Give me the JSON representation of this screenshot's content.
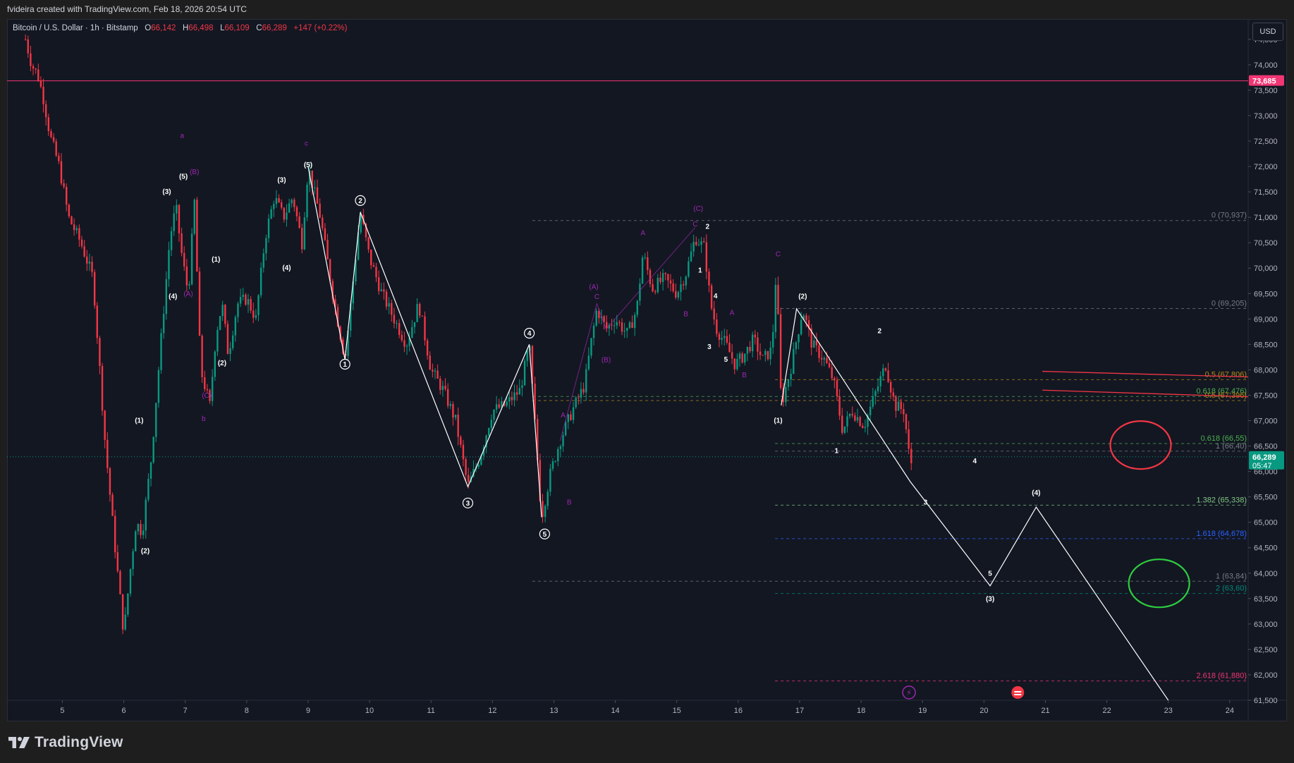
{
  "header": {
    "credit": "fvideira created with TradingView.com, Feb 18, 2026 20:54 UTC"
  },
  "legend": {
    "title": "Bitcoin / U.S. Dollar · 1h · Bitstamp",
    "open_label": "O",
    "open": "66,142",
    "high_label": "H",
    "high": "66,498",
    "low_label": "L",
    "low": "66,109",
    "close_label": "C",
    "close": "66,289",
    "change": "+147 (+0.22%)"
  },
  "currency_button": "USD",
  "footer": {
    "brand": "TradingView"
  },
  "colors": {
    "up": "#089981",
    "down": "#f23645",
    "background": "#131722",
    "wave_purple": "#9c27b0",
    "resistance": "#f23674",
    "accent_blue": "#2962ff"
  },
  "chart_data": {
    "type": "candlestick",
    "symbol": "Bitcoin / U.S. Dollar",
    "timeframe": "1h",
    "exchange": "Bitstamp",
    "y_axis": {
      "min": 61500,
      "max": 74900,
      "ticks": [
        "61,500",
        "62,000",
        "62,500",
        "63,000",
        "63,500",
        "64,000",
        "64,500",
        "65,000",
        "65,500",
        "66,000",
        "66,500",
        "67,000",
        "67,500",
        "68,000",
        "68,500",
        "69,000",
        "69,500",
        "70,000",
        "70,500",
        "71,000",
        "71,500",
        "72,000",
        "72,500",
        "73,000",
        "73,500",
        "74,000",
        "74,500"
      ]
    },
    "x_axis": {
      "start_day": 4.1,
      "end_day": 24.3,
      "ticks": [
        "5",
        "6",
        "7",
        "8",
        "9",
        "10",
        "11",
        "12",
        "13",
        "14",
        "15",
        "16",
        "17",
        "18",
        "19",
        "20",
        "21",
        "22",
        "23",
        "24"
      ]
    },
    "price_badges": [
      {
        "value": 73685,
        "label": "73,685",
        "color": "#f23674"
      },
      {
        "value": 66289,
        "label": "66,289",
        "countdown": "05:47",
        "color": "#089981"
      }
    ],
    "resistance_line": 73685,
    "current_price": 66289,
    "price_path": [
      [
        4.4,
        74500
      ],
      [
        4.5,
        74000
      ],
      [
        4.6,
        73800
      ],
      [
        4.7,
        73300
      ],
      [
        4.8,
        72600
      ],
      [
        4.95,
        72000
      ],
      [
        5.1,
        71000
      ],
      [
        5.3,
        70500
      ],
      [
        5.5,
        69800
      ],
      [
        5.7,
        66500
      ],
      [
        5.85,
        64600
      ],
      [
        6.0,
        62800
      ],
      [
        6.1,
        64000
      ],
      [
        6.2,
        65000
      ],
      [
        6.3,
        64800
      ],
      [
        6.45,
        66300
      ],
      [
        6.6,
        68500
      ],
      [
        6.75,
        70600
      ],
      [
        6.85,
        71200
      ],
      [
        6.95,
        70200
      ],
      [
        7.05,
        69500
      ],
      [
        7.15,
        71300
      ],
      [
        7.25,
        68000
      ],
      [
        7.4,
        67300
      ],
      [
        7.5,
        68700
      ],
      [
        7.6,
        69300
      ],
      [
        7.7,
        68300
      ],
      [
        7.85,
        69300
      ],
      [
        8.0,
        69400
      ],
      [
        8.15,
        69000
      ],
      [
        8.3,
        70600
      ],
      [
        8.45,
        71400
      ],
      [
        8.6,
        71000
      ],
      [
        8.75,
        71400
      ],
      [
        8.9,
        70500
      ],
      [
        9.0,
        72000
      ],
      [
        9.2,
        71000
      ],
      [
        9.4,
        69500
      ],
      [
        9.6,
        68200
      ],
      [
        9.85,
        71100
      ],
      [
        10.0,
        70200
      ],
      [
        10.2,
        69500
      ],
      [
        10.4,
        69000
      ],
      [
        10.6,
        68500
      ],
      [
        10.8,
        69300
      ],
      [
        11.0,
        68000
      ],
      [
        11.2,
        67600
      ],
      [
        11.4,
        67000
      ],
      [
        11.6,
        65700
      ],
      [
        11.8,
        66300
      ],
      [
        12.0,
        67200
      ],
      [
        12.2,
        67300
      ],
      [
        12.45,
        67600
      ],
      [
        12.6,
        68500
      ],
      [
        12.7,
        66800
      ],
      [
        12.8,
        65100
      ],
      [
        12.95,
        66000
      ],
      [
        13.1,
        66600
      ],
      [
        13.3,
        67200
      ],
      [
        13.5,
        67700
      ],
      [
        13.6,
        68500
      ],
      [
        13.7,
        69200
      ],
      [
        13.85,
        68800
      ],
      [
        14.0,
        69000
      ],
      [
        14.2,
        68700
      ],
      [
        14.35,
        69200
      ],
      [
        14.45,
        70300
      ],
      [
        14.6,
        69600
      ],
      [
        14.8,
        69800
      ],
      [
        15.0,
        69500
      ],
      [
        15.15,
        69900
      ],
      [
        15.3,
        70600
      ],
      [
        15.45,
        70400
      ],
      [
        15.55,
        69300
      ],
      [
        15.65,
        68800
      ],
      [
        15.8,
        68500
      ],
      [
        15.95,
        68100
      ],
      [
        16.1,
        68300
      ],
      [
        16.25,
        68600
      ],
      [
        16.4,
        68200
      ],
      [
        16.55,
        68400
      ],
      [
        16.62,
        70000
      ],
      [
        16.7,
        67300
      ],
      [
        16.85,
        68000
      ],
      [
        17.05,
        69200
      ],
      [
        17.2,
        68500
      ],
      [
        17.4,
        68200
      ],
      [
        17.55,
        67800
      ],
      [
        17.7,
        66800
      ],
      [
        17.85,
        67200
      ],
      [
        18.05,
        66900
      ],
      [
        18.25,
        67600
      ],
      [
        18.4,
        68100
      ],
      [
        18.55,
        67300
      ],
      [
        18.7,
        67200
      ],
      [
        18.8,
        66100
      ],
      [
        18.85,
        66300
      ]
    ],
    "projection_path": [
      [
        16.7,
        67300
      ],
      [
        16.95,
        69200
      ],
      [
        18.8,
        65800
      ],
      [
        20.1,
        63750
      ],
      [
        20.85,
        65300
      ],
      [
        23.0,
        61500
      ]
    ],
    "completed_wave_path": [
      [
        9.0,
        72000
      ],
      [
        9.6,
        68200
      ],
      [
        9.85,
        71100
      ],
      [
        11.6,
        65700
      ],
      [
        12.6,
        68500
      ],
      [
        12.8,
        65100
      ]
    ],
    "wave_labels_white": [
      {
        "t": "(3)",
        "d": 6.7,
        "p": 71460
      },
      {
        "t": "(5)",
        "d": 6.97,
        "p": 71760
      },
      {
        "t": "(1)",
        "d": 7.5,
        "p": 70130
      },
      {
        "t": "(4)",
        "d": 6.8,
        "p": 69400
      },
      {
        "t": "(2)",
        "d": 7.6,
        "p": 68090
      },
      {
        "t": "(1)",
        "d": 6.25,
        "p": 66960
      },
      {
        "t": "(2)",
        "d": 6.35,
        "p": 64390
      },
      {
        "t": "(3)",
        "d": 8.57,
        "p": 71690
      },
      {
        "t": "(5)",
        "d": 9.0,
        "p": 71990
      },
      {
        "t": "(4)",
        "d": 8.65,
        "p": 69960
      },
      {
        "t": "(2)",
        "d": 17.05,
        "p": 69400
      },
      {
        "t": "(1)",
        "d": 16.65,
        "p": 66960
      },
      {
        "t": "(3)",
        "d": 20.1,
        "p": 63450
      },
      {
        "t": "(4)",
        "d": 20.85,
        "p": 65540
      },
      {
        "t": "2",
        "d": 15.5,
        "p": 70770
      },
      {
        "t": "1",
        "d": 15.38,
        "p": 69910
      },
      {
        "t": "4",
        "d": 15.63,
        "p": 69410
      },
      {
        "t": "3",
        "d": 15.53,
        "p": 68410
      },
      {
        "t": "5",
        "d": 15.8,
        "p": 68160
      },
      {
        "t": "2",
        "d": 18.3,
        "p": 68720
      },
      {
        "t": "1",
        "d": 17.6,
        "p": 66360
      },
      {
        "t": "4",
        "d": 19.85,
        "p": 66160
      },
      {
        "t": "3",
        "d": 19.05,
        "p": 65350
      },
      {
        "t": "5",
        "d": 20.1,
        "p": 63950
      }
    ],
    "wave_labels_circled": [
      {
        "t": "1",
        "d": 9.6,
        "p": 68110
      },
      {
        "t": "2",
        "d": 9.85,
        "p": 71330
      },
      {
        "t": "3",
        "d": 11.6,
        "p": 65380
      },
      {
        "t": "4",
        "d": 12.6,
        "p": 68720
      },
      {
        "t": "5",
        "d": 12.85,
        "p": 64770
      }
    ],
    "wave_labels_purple": [
      {
        "t": "a",
        "d": 6.95,
        "p": 72560
      },
      {
        "t": "(B)",
        "d": 7.15,
        "p": 71850
      },
      {
        "t": "(A)",
        "d": 7.05,
        "p": 69450
      },
      {
        "t": "(C)",
        "d": 7.35,
        "p": 67450
      },
      {
        "t": "b",
        "d": 7.3,
        "p": 66990
      },
      {
        "t": "c",
        "d": 8.97,
        "p": 72410
      },
      {
        "t": "(A)",
        "d": 13.65,
        "p": 69590
      },
      {
        "t": "C",
        "d": 13.7,
        "p": 69390
      },
      {
        "t": "(B)",
        "d": 13.85,
        "p": 68150
      },
      {
        "t": "A",
        "d": 13.15,
        "p": 67060
      },
      {
        "t": "B",
        "d": 13.25,
        "p": 65350
      },
      {
        "t": "A",
        "d": 14.45,
        "p": 70650
      },
      {
        "t": "B",
        "d": 15.15,
        "p": 69050
      },
      {
        "t": "(C)",
        "d": 15.35,
        "p": 71130
      },
      {
        "t": "C",
        "d": 15.3,
        "p": 70820
      },
      {
        "t": "A",
        "d": 15.9,
        "p": 69080
      },
      {
        "t": "B",
        "d": 16.1,
        "p": 67850
      },
      {
        "t": "C",
        "d": 16.65,
        "p": 70230
      }
    ],
    "fib_levels": [
      {
        "label": "0 (70,937)",
        "price": 70937,
        "from": 12.65,
        "color": "#787b86"
      },
      {
        "label": "0 (69,205)",
        "price": 69205,
        "from": 16.6,
        "color": "#787b86"
      },
      {
        "label": "0.5 (67,806)",
        "price": 67806,
        "from": 16.6,
        "color": "#b28a17"
      },
      {
        "label": "0.618 (67,476)",
        "price": 67476,
        "from": 12.65,
        "color": "#4caf50"
      },
      {
        "label": "0.5 (67,396)",
        "price": 67396,
        "from": 12.65,
        "color": "#b28a17"
      },
      {
        "label": "0.618 (66,55)",
        "price": 66550,
        "from": 16.6,
        "color": "#4caf50"
      },
      {
        "label": "1 (66,40)",
        "price": 66400,
        "from": 16.6,
        "color": "#787b86"
      },
      {
        "label": "1.382 (65,338)",
        "price": 65338,
        "from": 16.6,
        "color": "#81c784"
      },
      {
        "label": "1.618 (64,678)",
        "price": 64678,
        "from": 16.6,
        "color": "#2962ff"
      },
      {
        "label": "1 (63,84)",
        "price": 63840,
        "from": 12.65,
        "color": "#787b86"
      },
      {
        "label": "2 (63,60)",
        "price": 63600,
        "from": 16.6,
        "color": "#00897b"
      },
      {
        "label": "2.618 (61,880)",
        "price": 61880,
        "from": 16.6,
        "color": "#f23674"
      }
    ],
    "trend_lines": [
      {
        "from": [
          20.95,
          67970
        ],
        "to": [
          24.3,
          67860
        ],
        "color": "#f23645"
      },
      {
        "from": [
          20.95,
          67600
        ],
        "to": [
          24.3,
          67470
        ],
        "color": "#f23645"
      }
    ],
    "annotations": [
      {
        "shape": "ellipse",
        "color": "#f23645",
        "center_day": 22.55,
        "center_price": 66520,
        "note": "red hand-drawn circle"
      },
      {
        "shape": "ellipse",
        "color": "#2ecc40",
        "center_day": 22.85,
        "center_price": 63800,
        "note": "green hand-drawn circle"
      }
    ]
  }
}
